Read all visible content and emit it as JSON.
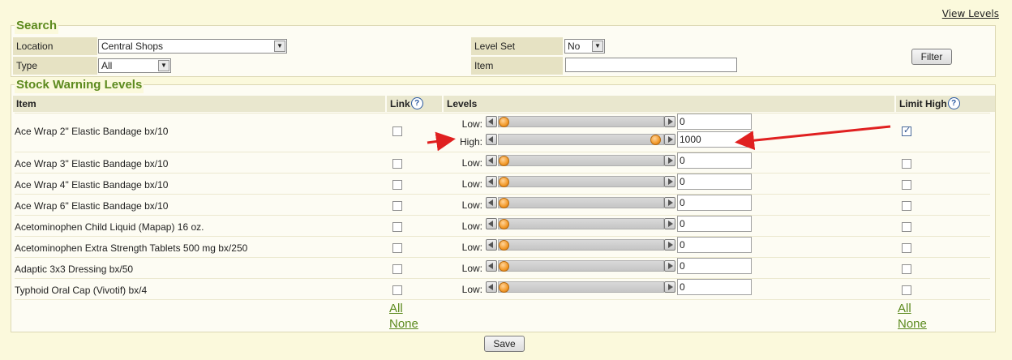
{
  "header": {
    "view_levels": "View Levels"
  },
  "search": {
    "title": "Search",
    "location_label": "Location",
    "location_value": "Central Shops",
    "type_label": "Type",
    "type_value": "All",
    "level_set_label": "Level Set",
    "level_set_value": "No",
    "item_label": "Item",
    "item_value": "",
    "filter_button": "Filter"
  },
  "stock": {
    "title": "Stock Warning Levels",
    "col_item": "Item",
    "col_link": "Link",
    "col_levels": "Levels",
    "col_limit_high": "Limit High",
    "help_glyph": "?",
    "low_label": "Low:",
    "high_label": "High:",
    "rows": [
      {
        "name": "Ace Wrap 2\" Elastic Bandage bx/10",
        "link": false,
        "low": "0",
        "high": "1000",
        "limit_high": true
      },
      {
        "name": "Ace Wrap 3\" Elastic Bandage bx/10",
        "link": false,
        "low": "0",
        "limit_high": false
      },
      {
        "name": "Ace Wrap 4\" Elastic Bandage bx/10",
        "link": false,
        "low": "0",
        "limit_high": false
      },
      {
        "name": "Ace Wrap 6\" Elastic Bandage bx/10",
        "link": false,
        "low": "0",
        "limit_high": false
      },
      {
        "name": "Acetominophen Child Liquid (Mapap) 16 oz.",
        "link": false,
        "low": "0",
        "limit_high": false
      },
      {
        "name": "Acetominophen Extra Strength Tablets 500 mg bx/250",
        "link": false,
        "low": "0",
        "limit_high": false
      },
      {
        "name": "Adaptic 3x3 Dressing bx/50",
        "link": false,
        "low": "0",
        "limit_high": false
      },
      {
        "name": "Typhoid Oral Cap (Vivotif) bx/4",
        "link": false,
        "low": "0",
        "limit_high": false
      }
    ],
    "link_all": "All",
    "link_none": "None",
    "limit_all": "All",
    "limit_none": "None"
  },
  "save_button": "Save",
  "colors": {
    "accent_green": "#5c8a1e",
    "annotation_red": "#e02020"
  }
}
